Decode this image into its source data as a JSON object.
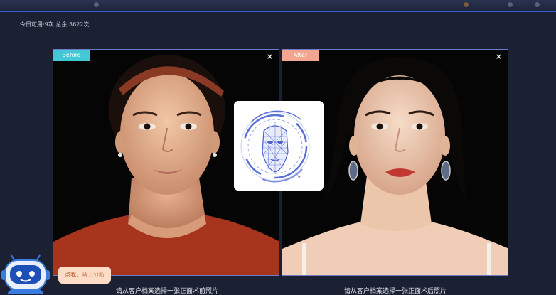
{
  "counter_text": "今日可用:9次 总余:3622次",
  "before_panel": {
    "tag": "Before",
    "close": "×",
    "caption": "请从客户档案选择一张正面术前照片"
  },
  "after_panel": {
    "tag": "After",
    "close": "×",
    "caption": "请从客户档案选择一张正面术后照片"
  },
  "assistant": {
    "bubble": "点我，马上分析"
  },
  "colors": {
    "accent": "#3c5bd6",
    "before_tag": "#44c8d6",
    "after_tag": "#f4a58f",
    "panel_border": "#6d79c9",
    "background": "#1b2133"
  }
}
